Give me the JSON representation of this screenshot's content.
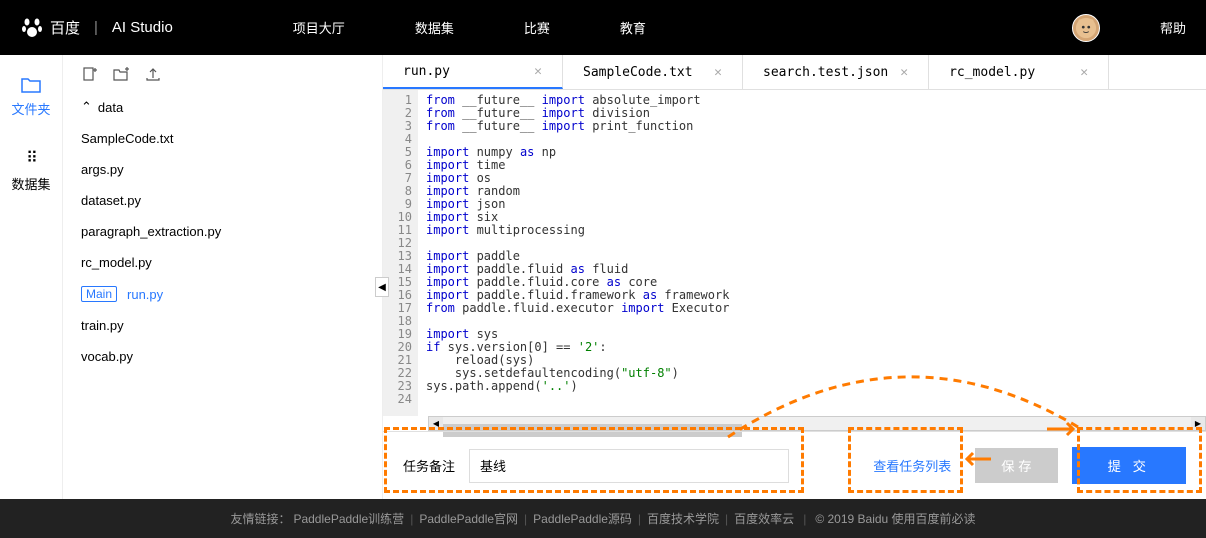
{
  "header": {
    "logo_text1": "百度",
    "logo_text2": "AI Studio",
    "nav_items": [
      "项目大厅",
      "数据集",
      "比赛",
      "教育"
    ],
    "help_label": "帮助"
  },
  "sidebar": {
    "tabs": [
      {
        "label": "文件夹"
      },
      {
        "label": "数据集"
      }
    ]
  },
  "explorer": {
    "folder_name": "data",
    "files": [
      "SampleCode.txt",
      "args.py",
      "dataset.py",
      "paragraph_extraction.py",
      "rc_model.py",
      "run.py",
      "train.py",
      "vocab.py"
    ],
    "main_badge": "Main",
    "main_file": "run.py"
  },
  "editor": {
    "tabs": [
      {
        "name": "run.py",
        "active": true
      },
      {
        "name": "SampleCode.txt",
        "active": false
      },
      {
        "name": "search.test.json",
        "active": false
      },
      {
        "name": "rc_model.py",
        "active": false
      }
    ],
    "lines": [
      {
        "n": 1,
        "tokens": [
          [
            "from",
            "kw-from"
          ],
          [
            " __future__ ",
            "mod"
          ],
          [
            "import",
            "kw-import"
          ],
          [
            " absolute_import",
            "mod"
          ]
        ]
      },
      {
        "n": 2,
        "tokens": [
          [
            "from",
            "kw-from"
          ],
          [
            " __future__ ",
            "mod"
          ],
          [
            "import",
            "kw-import"
          ],
          [
            " division",
            "mod"
          ]
        ]
      },
      {
        "n": 3,
        "tokens": [
          [
            "from",
            "kw-from"
          ],
          [
            " __future__ ",
            "mod"
          ],
          [
            "import",
            "kw-import"
          ],
          [
            " print_function",
            "mod"
          ]
        ]
      },
      {
        "n": 4,
        "tokens": []
      },
      {
        "n": 5,
        "tokens": [
          [
            "import",
            "kw-import"
          ],
          [
            " numpy ",
            "mod"
          ],
          [
            "as",
            "kw-as"
          ],
          [
            " np",
            "mod"
          ]
        ]
      },
      {
        "n": 6,
        "tokens": [
          [
            "import",
            "kw-import"
          ],
          [
            " time",
            "mod"
          ]
        ]
      },
      {
        "n": 7,
        "tokens": [
          [
            "import",
            "kw-import"
          ],
          [
            " os",
            "mod"
          ]
        ]
      },
      {
        "n": 8,
        "tokens": [
          [
            "import",
            "kw-import"
          ],
          [
            " random",
            "mod"
          ]
        ]
      },
      {
        "n": 9,
        "tokens": [
          [
            "import",
            "kw-import"
          ],
          [
            " json",
            "mod"
          ]
        ]
      },
      {
        "n": 10,
        "tokens": [
          [
            "import",
            "kw-import"
          ],
          [
            " six",
            "mod"
          ]
        ]
      },
      {
        "n": 11,
        "tokens": [
          [
            "import",
            "kw-import"
          ],
          [
            " multiprocessing",
            "mod"
          ]
        ]
      },
      {
        "n": 12,
        "tokens": []
      },
      {
        "n": 13,
        "tokens": [
          [
            "import",
            "kw-import"
          ],
          [
            " paddle",
            "mod"
          ]
        ]
      },
      {
        "n": 14,
        "tokens": [
          [
            "import",
            "kw-import"
          ],
          [
            " paddle.fluid ",
            "mod"
          ],
          [
            "as",
            "kw-as"
          ],
          [
            " fluid",
            "mod"
          ]
        ]
      },
      {
        "n": 15,
        "tokens": [
          [
            "import",
            "kw-import"
          ],
          [
            " paddle.fluid.core ",
            "mod"
          ],
          [
            "as",
            "kw-as"
          ],
          [
            " core",
            "mod"
          ]
        ]
      },
      {
        "n": 16,
        "tokens": [
          [
            "import",
            "kw-import"
          ],
          [
            " paddle.fluid.framework ",
            "mod"
          ],
          [
            "as",
            "kw-as"
          ],
          [
            " framework",
            "mod"
          ]
        ]
      },
      {
        "n": 17,
        "tokens": [
          [
            "from",
            "kw-from"
          ],
          [
            " paddle.fluid.executor ",
            "mod"
          ],
          [
            "import",
            "kw-import"
          ],
          [
            " Executor",
            "mod"
          ]
        ]
      },
      {
        "n": 18,
        "tokens": []
      },
      {
        "n": 19,
        "tokens": [
          [
            "import",
            "kw-import"
          ],
          [
            " sys",
            "mod"
          ]
        ]
      },
      {
        "n": 20,
        "fold": true,
        "tokens": [
          [
            "if",
            "kw-if"
          ],
          [
            " sys.version[",
            "mod"
          ],
          [
            "0",
            "num"
          ],
          [
            "] == ",
            "op"
          ],
          [
            "'2'",
            "str"
          ],
          [
            ":",
            "op"
          ]
        ]
      },
      {
        "n": 21,
        "tokens": [
          [
            "    reload(sys)",
            "mod"
          ]
        ]
      },
      {
        "n": 22,
        "tokens": [
          [
            "    sys.setdefaultencoding(",
            "mod"
          ],
          [
            "\"utf-8\"",
            "str"
          ],
          [
            ")",
            "mod"
          ]
        ]
      },
      {
        "n": 23,
        "tokens": [
          [
            "sys.path.append(",
            "mod"
          ],
          [
            "'..'",
            "str"
          ],
          [
            ")",
            "mod"
          ]
        ]
      },
      {
        "n": 24,
        "tokens": []
      }
    ]
  },
  "action_bar": {
    "task_label": "任务备注",
    "task_value": "基线",
    "view_tasks": "查看任务列表",
    "save_label": "保 存",
    "submit_label": "提 交"
  },
  "footer": {
    "prefix": "友情链接：",
    "links": [
      "PaddlePaddle训练营",
      "PaddlePaddle官网",
      "PaddlePaddle源码",
      "百度技术学院",
      "百度效率云"
    ],
    "copyright": "© 2019 Baidu 使用百度前必读"
  }
}
